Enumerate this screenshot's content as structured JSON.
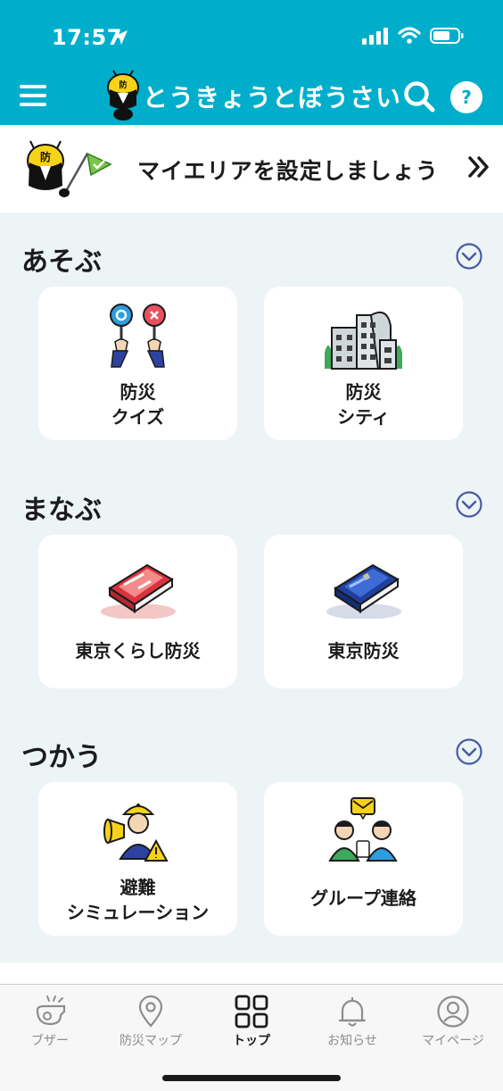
{
  "status_bar": {
    "time": "17:57"
  },
  "header": {
    "title": "とうきょうとぼうさい",
    "icons": [
      "menu-icon",
      "mascot-logo",
      "search-icon",
      "help-icon"
    ],
    "help_label": "?",
    "mascot_badge": "防",
    "background_color": "#00aecb"
  },
  "area_banner": {
    "text": "マイエリアを設定しましょう",
    "mascot_badge": "防",
    "arrow": "»"
  },
  "sections": [
    {
      "title": "あそぶ",
      "cards": [
        {
          "line1": "防災",
          "line2": "クイズ",
          "icon": "quiz-paddles-icon"
        },
        {
          "line1": "防災",
          "line2": "シティ",
          "icon": "city-buildings-icon"
        }
      ]
    },
    {
      "title": "まなぶ",
      "cards": [
        {
          "line1": "東京くらし防災",
          "line2": "",
          "icon": "red-book-icon"
        },
        {
          "line1": "東京防災",
          "line2": "",
          "icon": "blue-book-icon"
        }
      ]
    },
    {
      "title": "つかう",
      "cards": [
        {
          "line1": "避難",
          "line2": "シミュレーション",
          "icon": "evacuation-megaphone-icon"
        },
        {
          "line1": "グループ連絡",
          "line2": "",
          "icon": "group-contact-icon"
        }
      ]
    }
  ],
  "tab_bar": {
    "tabs": [
      {
        "label": "ブザー",
        "icon": "whistle-icon",
        "active": false
      },
      {
        "label": "防災マップ",
        "icon": "map-pin-icon",
        "active": false
      },
      {
        "label": "トップ",
        "icon": "grid-icon",
        "active": true
      },
      {
        "label": "お知らせ",
        "icon": "bell-icon",
        "active": false
      },
      {
        "label": "マイページ",
        "icon": "profile-icon",
        "active": false
      }
    ]
  }
}
